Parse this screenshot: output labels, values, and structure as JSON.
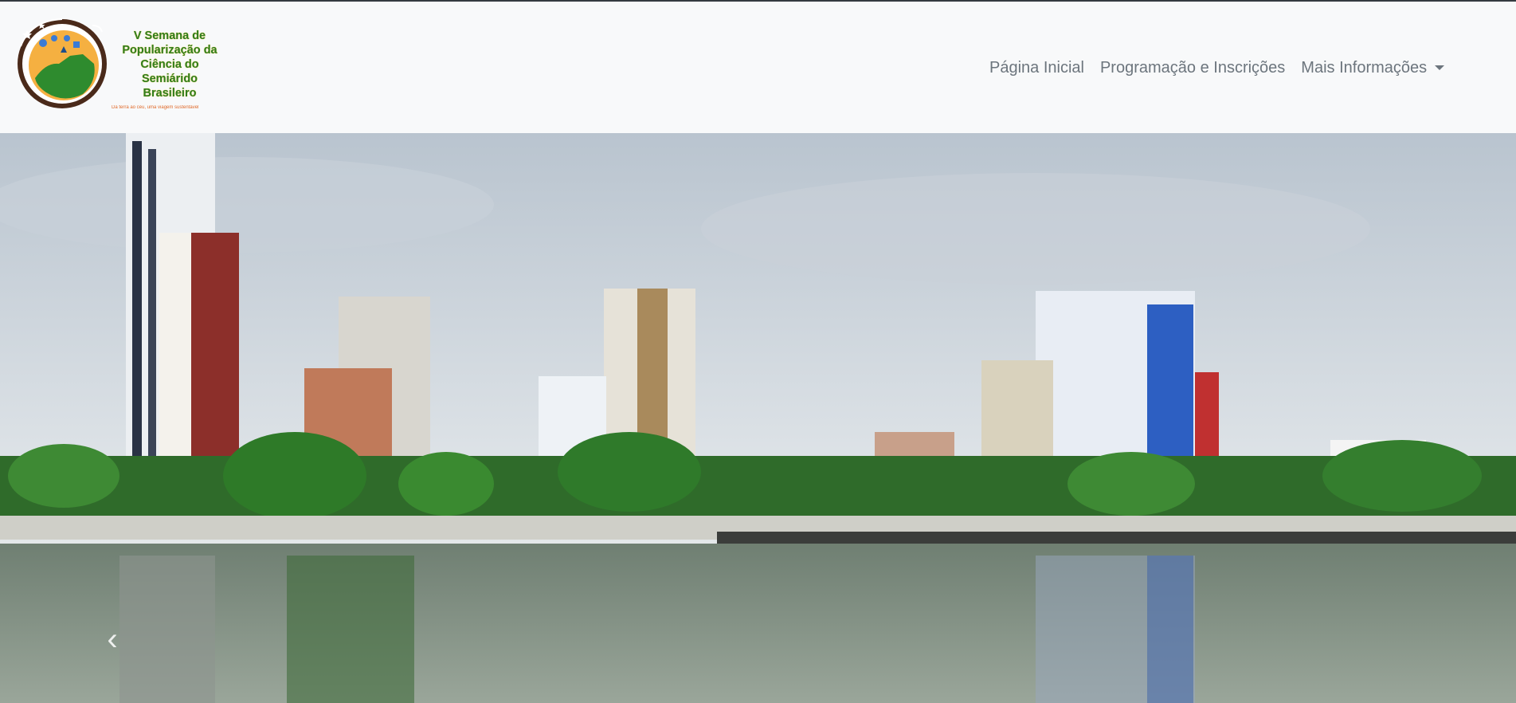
{
  "brand": {
    "title": "V Semana de Popularização da Ciência do Semiárido Brasileiro",
    "slogan": "Da terra ao céu, uma viagem sustentável",
    "colors": {
      "green": "#2e7d1f",
      "orange": "#f5a623",
      "brown": "#4a2a1a"
    }
  },
  "nav": {
    "items": [
      {
        "label": "Página Inicial"
      },
      {
        "label": "Programação e Inscrições"
      },
      {
        "label": "Mais Informações",
        "icon": "chevron-down-icon"
      }
    ]
  },
  "hero": {
    "image": "city-skyline-lagoon",
    "prev_icon": "chevron-left-icon",
    "prev_glyph": "‹"
  }
}
